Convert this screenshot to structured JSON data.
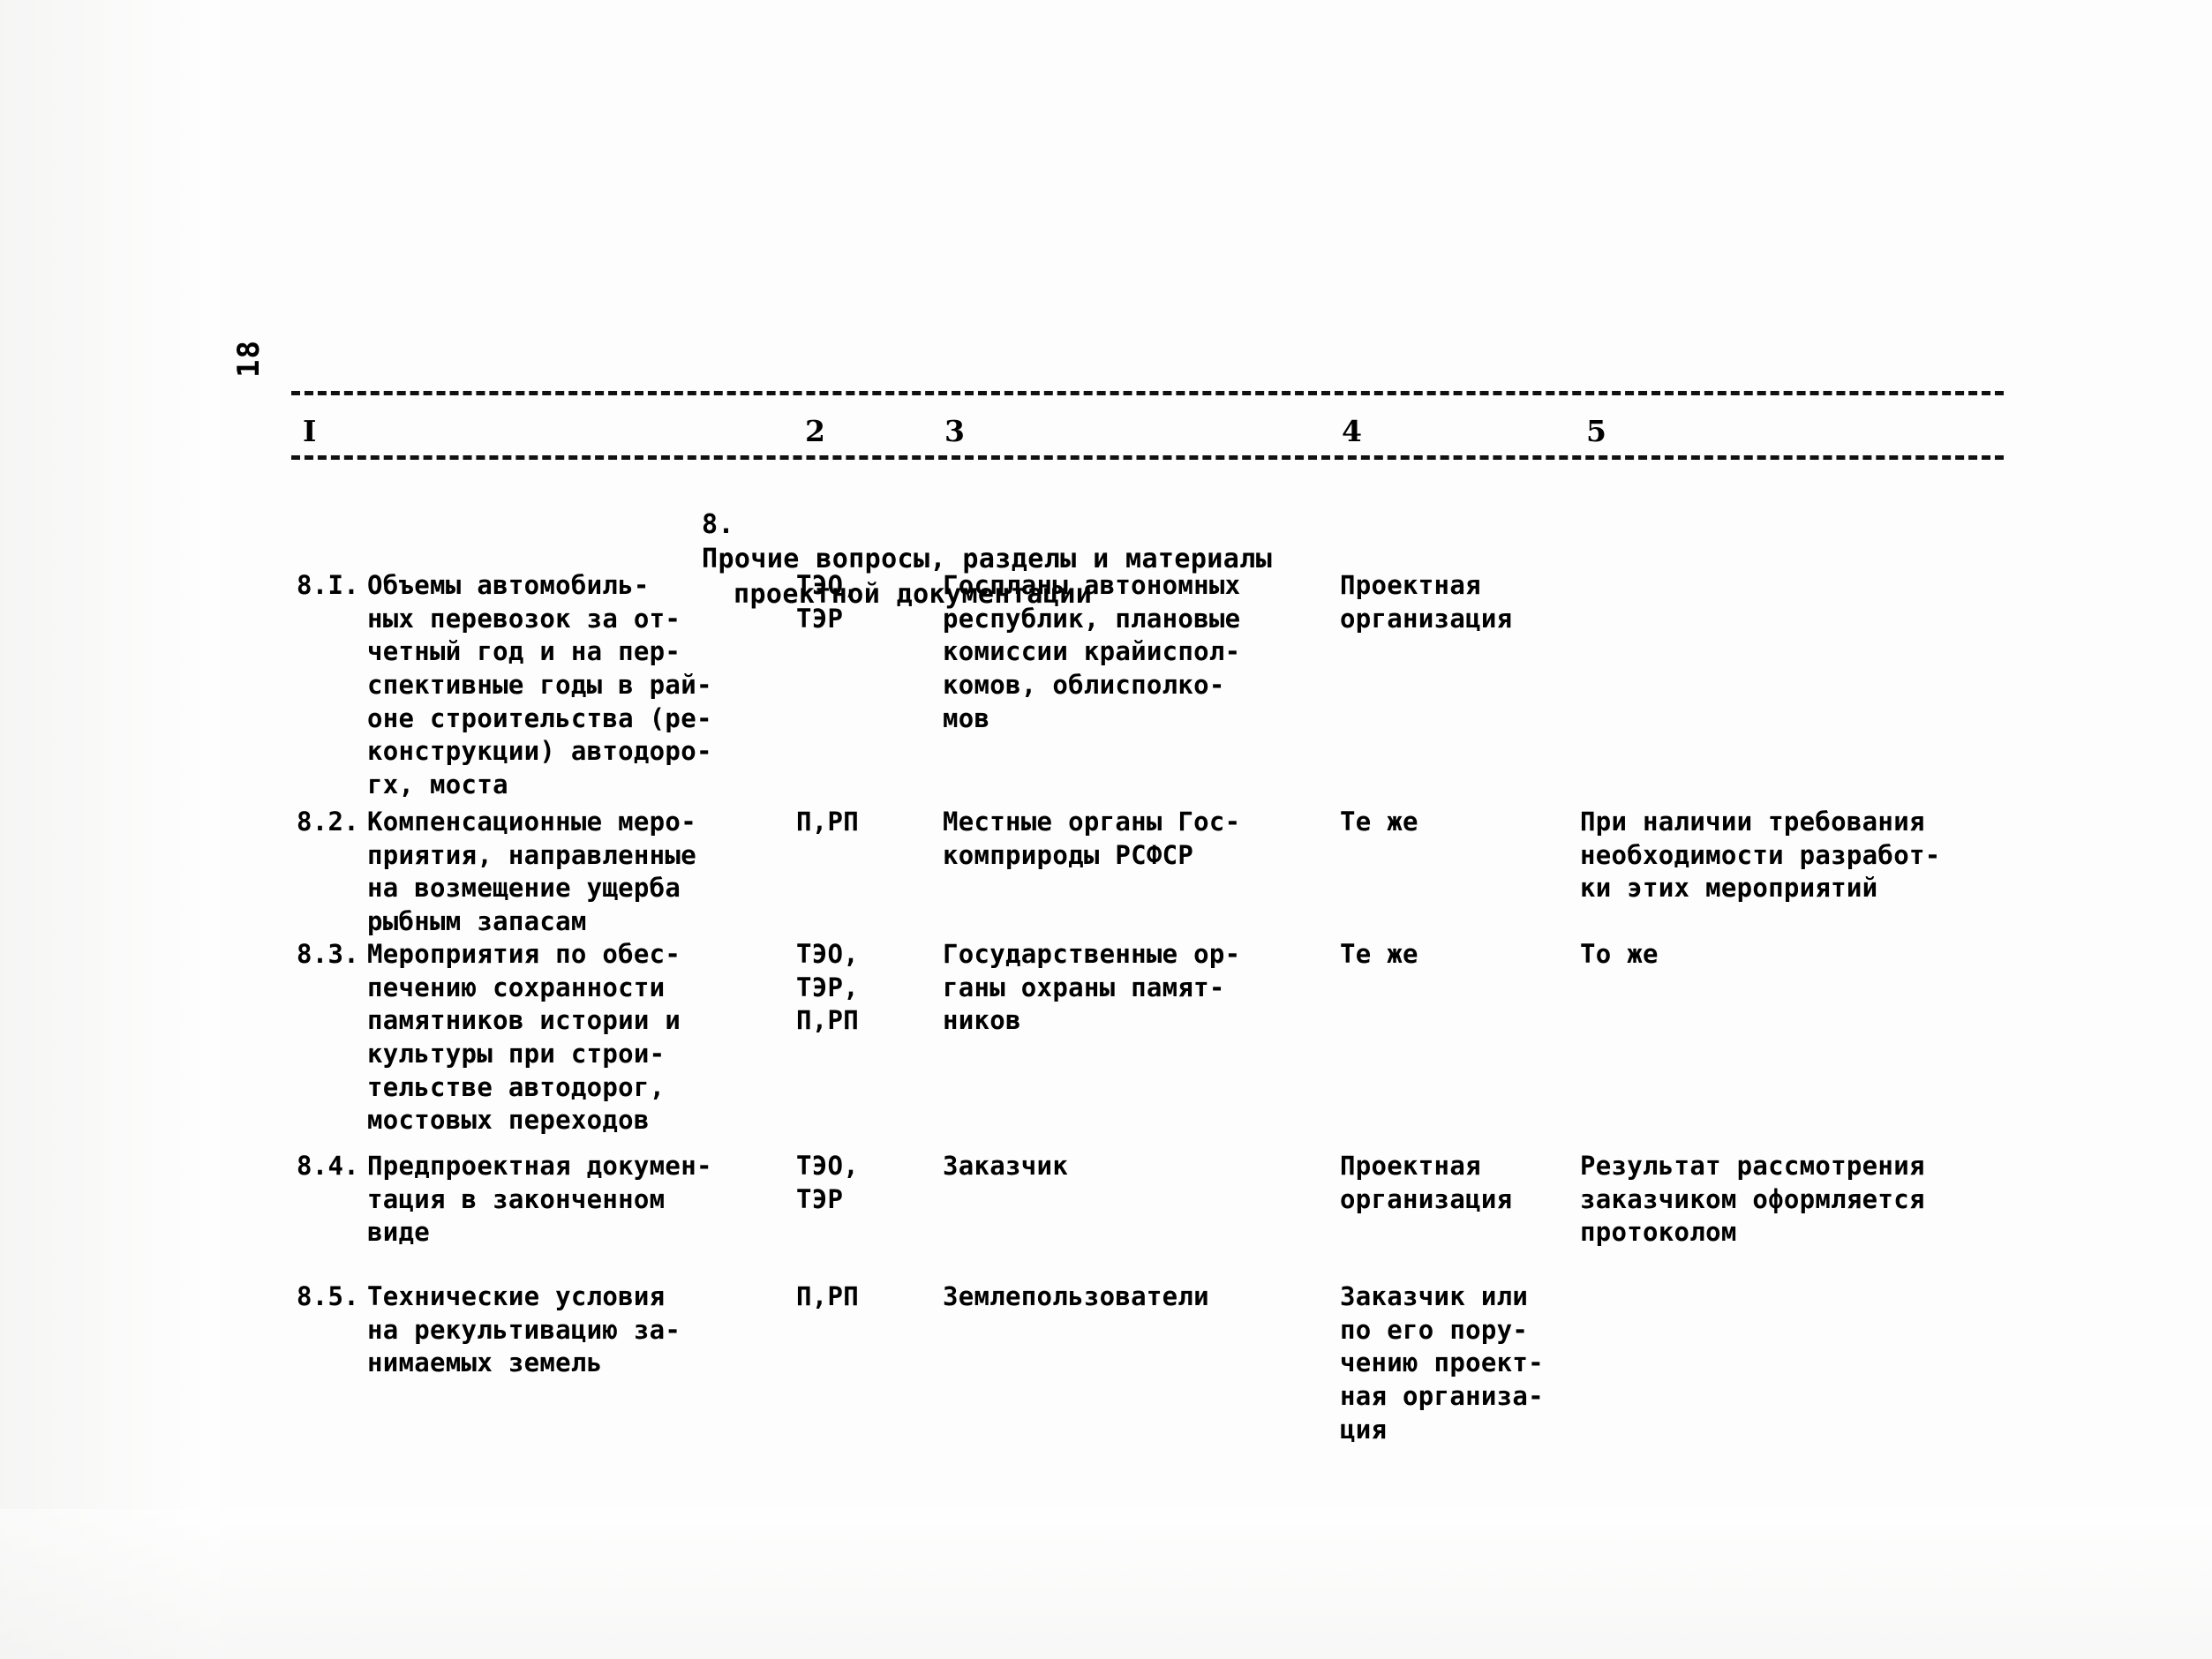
{
  "page": {
    "number": "18"
  },
  "column_header": {
    "numbers": [
      "I",
      "2",
      "3",
      "4",
      "5"
    ]
  },
  "section": {
    "number": "8.",
    "title_line1": "Прочие вопросы, разделы и материалы",
    "title_line2": "проектной документации"
  },
  "table": {
    "rows": [
      {
        "num": "8.I.",
        "name": "Объемы автомобиль-\nных перевозок за от-\nчетный год и на пер-\nспективные годы в рай-\nоне строительства (ре-\nконструкции) автодоро-\nгх, моста",
        "stage": "ТЭО,\nТЭР",
        "source": "Госпланы автономных\nреспублик, плановые\nкомиссии крайиспол-\nкомов, облисполко-\nмов",
        "responsible": "Проектная\nорганизация",
        "note": ""
      },
      {
        "num": "8.2.",
        "name": "Компенсационные меро-\nприятия, направленные\nна возмещение ущерба\nрыбным запасам",
        "stage": "П,РП",
        "source": "Местные органы Гос-\nкомприроды РСФСР",
        "responsible": "Те же",
        "note": "При наличии требования\nнеобходимости разработ-\nки этих мероприятий"
      },
      {
        "num": "8.3.",
        "name": "Мероприятия по обес-\nпечению сохранности\nпамятников истории и\nкультуры при строи-\nтельстве автодорог,\nмостовых переходов",
        "stage": "ТЭО,\nТЭР,\nП,РП",
        "source": "Государственные ор-\nганы охраны памят-\nников",
        "responsible": "Те же",
        "note": "То же"
      },
      {
        "num": "8.4.",
        "name": "Предпроектная докумен-\nтация в законченном\nвиде",
        "stage": "ТЭО,\nТЭР",
        "source": "Заказчик",
        "responsible": "Проектная\nорганизация",
        "note": "Результат рассмотрения\nзаказчиком оформляется\nпротоколом"
      },
      {
        "num": "8.5.",
        "name": "Технические условия\nна рекультивацию за-\nнимаемых земель",
        "stage": "П,РП",
        "source": "Землепользователи",
        "responsible": "Заказчик или\nпо его пору-\nчению проект-\nная организа-\nция",
        "note": ""
      }
    ]
  }
}
